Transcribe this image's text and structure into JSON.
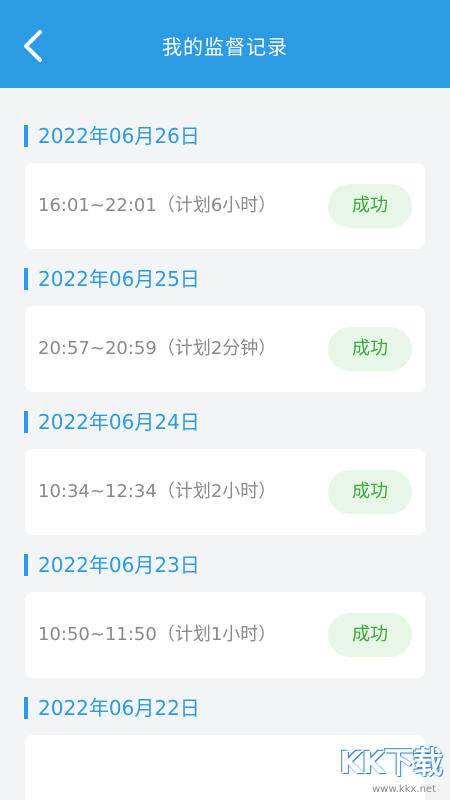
{
  "header": {
    "title": "我的监督记录",
    "back_icon": "chevron-left-icon"
  },
  "colors": {
    "accent": "#2b9be3",
    "success_text": "#3aa83a",
    "success_bg": "#e7f6e6"
  },
  "records": [
    {
      "date": "2022年06月26日",
      "time": "16:01~22:01（计划6小时）",
      "status": "成功"
    },
    {
      "date": "2022年06月25日",
      "time": "20:57~20:59（计划2分钟）",
      "status": "成功"
    },
    {
      "date": "2022年06月24日",
      "time": "10:34~12:34（计划2小时）",
      "status": "成功"
    },
    {
      "date": "2022年06月23日",
      "time": "10:50~11:50（计划1小时）",
      "status": "成功"
    },
    {
      "date": "2022年06月22日",
      "time": "",
      "status": ""
    }
  ],
  "watermark": {
    "logo": "KK下载",
    "url": "www.kkx.net"
  }
}
